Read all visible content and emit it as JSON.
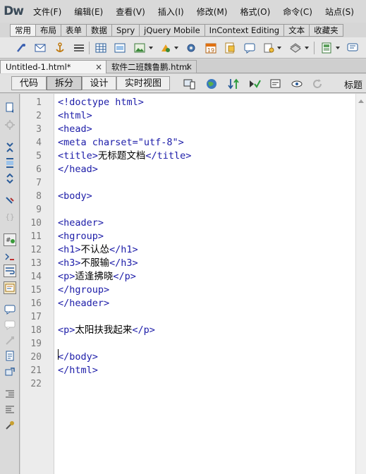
{
  "app": {
    "logo": "Dw"
  },
  "menu": [
    "文件(F)",
    "编辑(E)",
    "查看(V)",
    "插入(I)",
    "修改(M)",
    "格式(O)",
    "命令(C)",
    "站点(S)"
  ],
  "insert_panel": {
    "tabs": [
      "常用",
      "布局",
      "表单",
      "数据",
      "Spry",
      "jQuery Mobile",
      "InContext Editing",
      "文本",
      "收藏夹"
    ],
    "active_tab": "常用",
    "date_icon_text": "19",
    "icons": [
      "hyperlink-icon",
      "email-link-icon",
      "named-anchor-icon",
      "horizontal-rule-icon",
      "table-icon",
      "insert-div-icon",
      "images-icon",
      "media-icon",
      "widget-icon",
      "date-icon",
      "server-side-include-icon",
      "comment-icon",
      "head-icon",
      "script-icon",
      "templates-icon",
      "tag-chooser-icon"
    ]
  },
  "document_tabs": [
    {
      "label": "Untitled-1.html*",
      "active": true,
      "close": "×"
    },
    {
      "label": "软件二班魏鲁鹏.html",
      "active": false,
      "close": "×"
    }
  ],
  "document_toolbar": {
    "views": [
      {
        "label": "代码",
        "selected": false
      },
      {
        "label": "拆分",
        "selected": true
      },
      {
        "label": "设计",
        "selected": false
      },
      {
        "label": "实时视图",
        "selected": false
      }
    ],
    "title_label": "标题"
  },
  "editor": {
    "line_numbers": [
      "1",
      "2",
      "3",
      "4",
      "5",
      "6",
      "7",
      "8",
      "9",
      "10",
      "11",
      "12",
      "13",
      "14",
      "15",
      "16",
      "17",
      "18",
      "19",
      "20",
      "21",
      "22"
    ],
    "lines": [
      {
        "pre": "<!doctype html>",
        "txt": "",
        "post": ""
      },
      {
        "pre": "<html>",
        "txt": "",
        "post": ""
      },
      {
        "pre": "<head>",
        "txt": "",
        "post": ""
      },
      {
        "pre": "<meta charset=\"utf-8\">",
        "txt": "",
        "post": ""
      },
      {
        "pre": "<title>",
        "txt": "无标题文档",
        "post": "</title>"
      },
      {
        "pre": "</head>",
        "txt": "",
        "post": ""
      },
      {
        "pre": "",
        "txt": "",
        "post": ""
      },
      {
        "pre": "<body>",
        "txt": "",
        "post": ""
      },
      {
        "pre": "",
        "txt": "",
        "post": ""
      },
      {
        "pre": "<header>",
        "txt": "",
        "post": ""
      },
      {
        "pre": "<hgroup>",
        "txt": "",
        "post": ""
      },
      {
        "pre": "<h1>",
        "txt": "不认怂",
        "post": "</h1>"
      },
      {
        "pre": "<h3>",
        "txt": "不服输",
        "post": "</h3>"
      },
      {
        "pre": "<p>",
        "txt": "适逢拂晓",
        "post": "</p>"
      },
      {
        "pre": "</hgroup>",
        "txt": "",
        "post": ""
      },
      {
        "pre": "</header>",
        "txt": "",
        "post": ""
      },
      {
        "pre": "",
        "txt": "",
        "post": ""
      },
      {
        "pre": "<p>",
        "txt": "太阳扶我起来",
        "post": "</p>"
      },
      {
        "pre": "",
        "txt": "",
        "post": ""
      },
      {
        "pre": "</body>",
        "txt": "",
        "post": ""
      },
      {
        "pre": "</html>",
        "txt": "",
        "post": ""
      },
      {
        "pre": "",
        "txt": "",
        "post": ""
      }
    ]
  },
  "colors": {
    "tag": "#1c1ca8",
    "text": "#000000",
    "gutter_text": "#7a7a7a"
  }
}
